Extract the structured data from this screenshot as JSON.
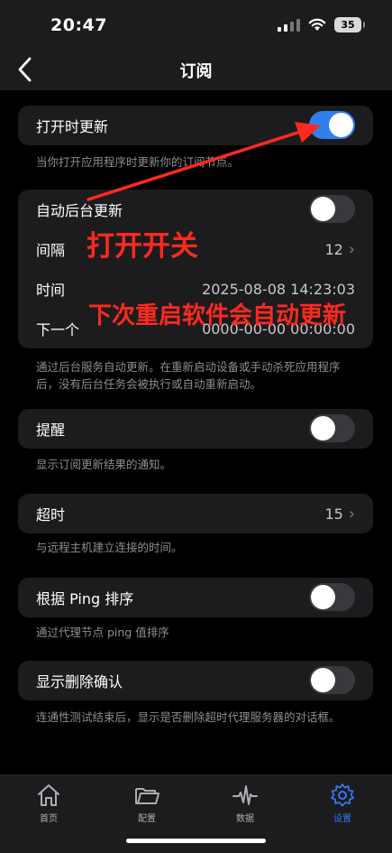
{
  "status_bar": {
    "time": "20:47",
    "battery": "35"
  },
  "nav": {
    "title": "订阅"
  },
  "open_update": {
    "label": "打开时更新",
    "toggle_on": true,
    "footer": "当你打开应用程序时更新你的订阅节点。"
  },
  "background": {
    "auto_label": "自动后台更新",
    "auto_on": false,
    "interval_label": "间隔",
    "interval_value": "12",
    "time_label": "时间",
    "time_value": "2025-08-08 14:23:03",
    "next_label": "下一个",
    "next_value": "0000-00-00 00:00:00",
    "footer": "通过后台服务自动更新。在重新启动设备或手动杀死应用程序后，没有后台任务会被执行或自动重新启动。"
  },
  "reminder": {
    "label": "提醒",
    "on": false,
    "footer": "显示订阅更新结果的通知。"
  },
  "timeout": {
    "label": "超时",
    "value": "15",
    "footer": "与远程主机建立连接的时间。"
  },
  "ping_sort": {
    "label": "根据 Ping 排序",
    "on": false,
    "footer": "通过代理节点 ping 值排序"
  },
  "delete_confirm": {
    "label": "显示删除确认",
    "on": false,
    "footer": "连通性测试结束后，显示是否删除超时代理服务器的对话框。"
  },
  "annotations": {
    "open_switch": "打开开关",
    "restart_note": "下次重启软件会自动更新"
  },
  "tabs": [
    {
      "label": "首页",
      "icon": "home-icon",
      "active": false
    },
    {
      "label": "配置",
      "icon": "folder-icon",
      "active": false
    },
    {
      "label": "数据",
      "icon": "waveform-icon",
      "active": false
    },
    {
      "label": "设置",
      "icon": "gear-icon",
      "active": true
    }
  ],
  "colors": {
    "accent": "#3478f6",
    "toggle_on": "#2f80ed",
    "annotation": "#ff2a1f",
    "background": "#000000",
    "cell": "#1c1c1e"
  }
}
